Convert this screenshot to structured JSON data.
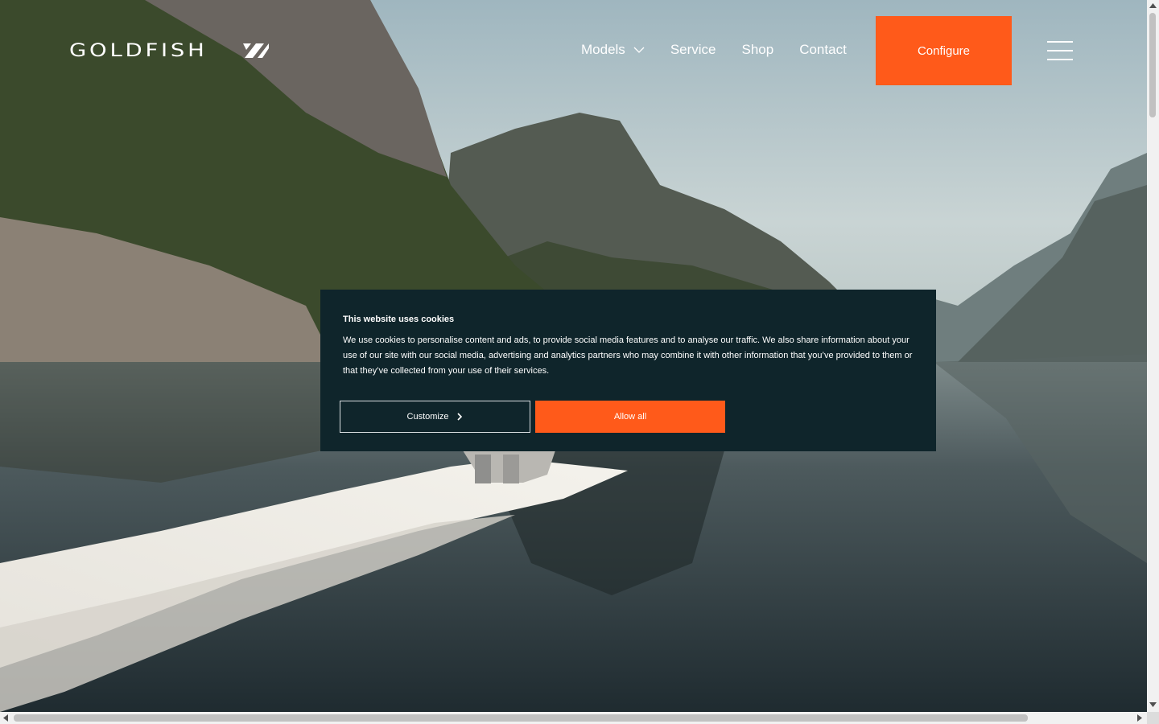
{
  "header": {
    "logo_text": "GOLDFISH",
    "nav": [
      {
        "label": "Models",
        "has_dropdown": true
      },
      {
        "label": "Service"
      },
      {
        "label": "Shop"
      },
      {
        "label": "Contact"
      }
    ],
    "configure_label": "Configure",
    "menu_icon": "hamburger-icon"
  },
  "cookie_banner": {
    "title": "This website uses cookies",
    "text": "We use cookies to personalise content and ads, to provide social media features and to analyse our traffic. We also share information about your use of our site with our social media, advertising and analytics partners who may combine it with other information that you’ve provided to them or that they’ve collected from your use of their services.",
    "customize_label": "Customize",
    "allow_label": "Allow all"
  },
  "colors": {
    "accent": "#ff5a1a",
    "banner_bg": "#0f252b"
  }
}
